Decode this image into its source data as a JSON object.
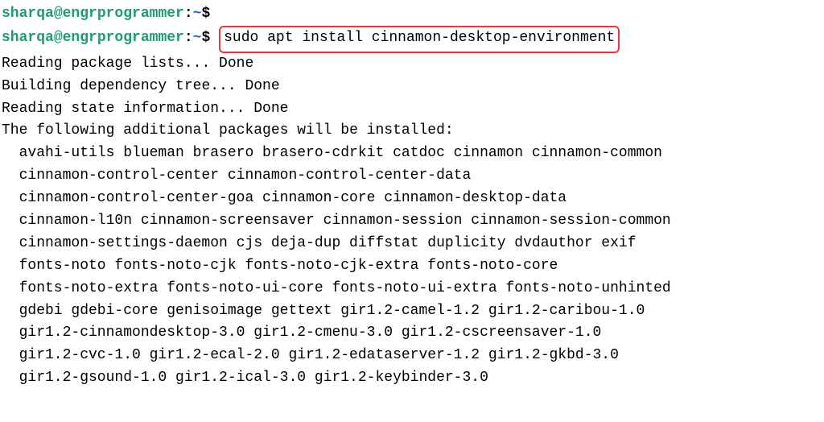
{
  "prompt": {
    "user": "sharqa",
    "at": "@",
    "host": "engrprogrammer",
    "colon": ":",
    "path": "~",
    "dollar": "$"
  },
  "command": "sudo apt install cinnamon-desktop-environment",
  "output": {
    "line1": "Reading package lists... Done",
    "line2": "Building dependency tree... Done",
    "line3": "Reading state information... Done",
    "line4": "The following additional packages will be installed:",
    "pkg1": "avahi-utils blueman brasero brasero-cdrkit catdoc cinnamon cinnamon-common",
    "pkg2": "cinnamon-control-center cinnamon-control-center-data",
    "pkg3": "cinnamon-control-center-goa cinnamon-core cinnamon-desktop-data",
    "pkg4": "cinnamon-l10n cinnamon-screensaver cinnamon-session cinnamon-session-common",
    "pkg5": "cinnamon-settings-daemon cjs deja-dup diffstat duplicity dvdauthor exif",
    "pkg6": "fonts-noto fonts-noto-cjk fonts-noto-cjk-extra fonts-noto-core",
    "pkg7": "fonts-noto-extra fonts-noto-ui-core fonts-noto-ui-extra fonts-noto-unhinted",
    "pkg8": "gdebi gdebi-core genisoimage gettext gir1.2-camel-1.2 gir1.2-caribou-1.0",
    "pkg9": "gir1.2-cinnamondesktop-3.0 gir1.2-cmenu-3.0 gir1.2-cscreensaver-1.0",
    "pkg10": "gir1.2-cvc-1.0 gir1.2-ecal-2.0 gir1.2-edataserver-1.2 gir1.2-gkbd-3.0",
    "pkg11": "gir1.2-gsound-1.0 gir1.2-ical-3.0 gir1.2-keybinder-3.0"
  }
}
